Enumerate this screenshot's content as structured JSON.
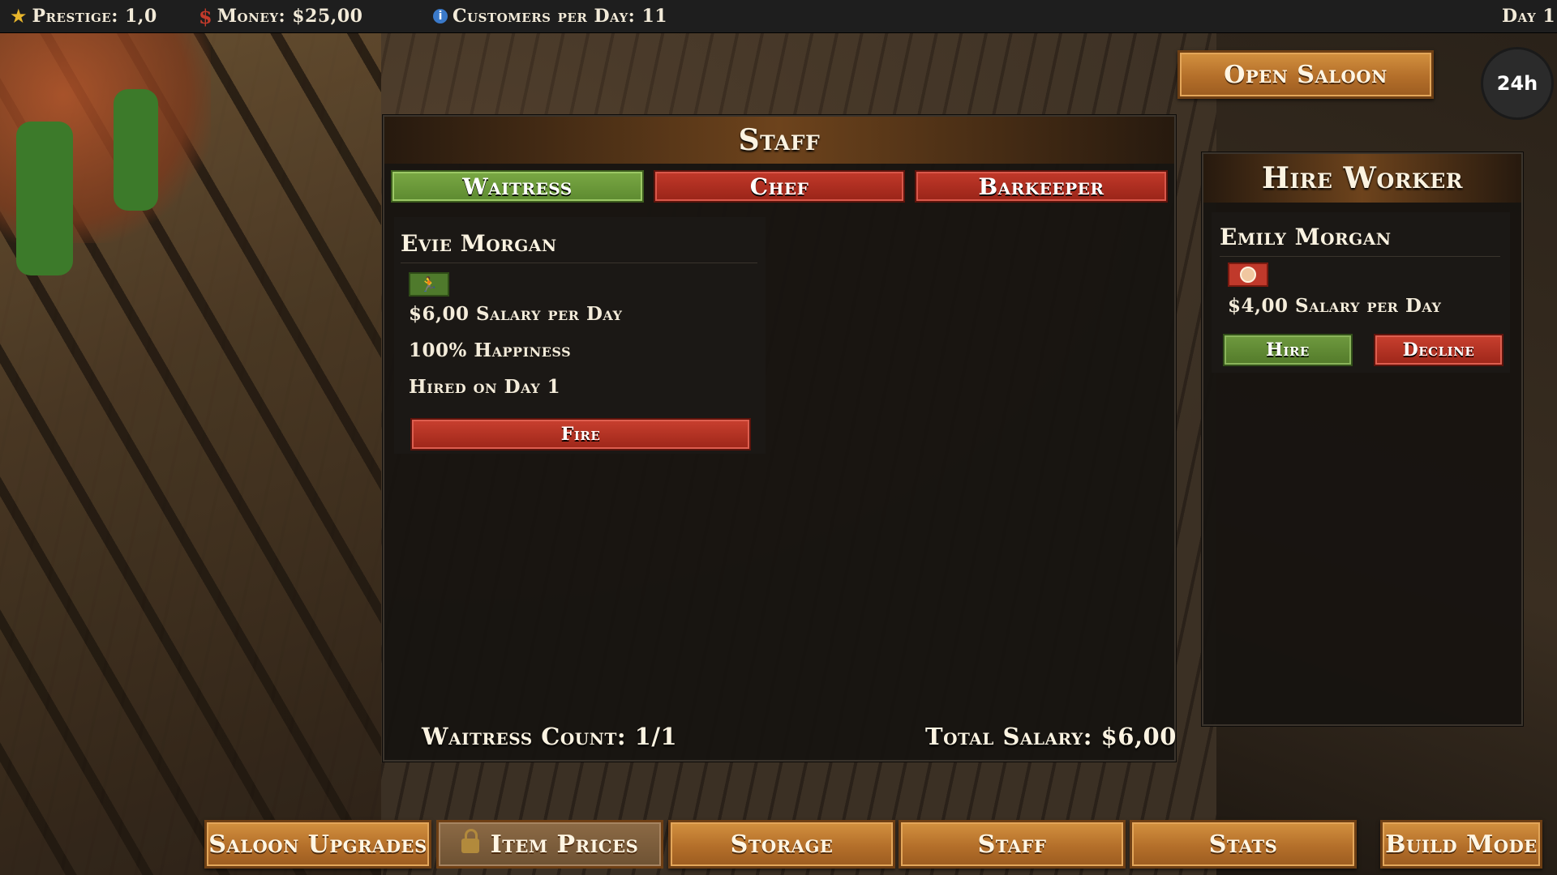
{
  "topbar": {
    "prestige": "Prestige: 1,0",
    "money": "Money: $25,00",
    "customers": "Customers per Day: 11",
    "day": "Day 1"
  },
  "header_actions": {
    "open_saloon": "Open Saloon",
    "clock": "24h"
  },
  "staff_panel": {
    "title": "Staff",
    "tabs": [
      {
        "label": "Waitress",
        "active": true
      },
      {
        "label": "Chef",
        "active": false
      },
      {
        "label": "Barkeeper",
        "active": false
      }
    ],
    "worker": {
      "name": "Evie Morgan",
      "role_icon": "running-waitress-icon",
      "salary": "$6,00 Salary per Day",
      "happiness": "100% Happiness",
      "hired": "Hired on Day 1",
      "fire_label": "Fire"
    },
    "count": "Waitress Count: 1/1",
    "total_salary": "Total Salary: $6,00"
  },
  "hire_panel": {
    "title": "Hire Worker",
    "candidate": {
      "name": "Emily Morgan",
      "icon": "face-icon",
      "salary": "$4,00 Salary per Day",
      "hire_label": "Hire",
      "decline_label": "Decline"
    }
  },
  "bottom_bar": {
    "saloon_upgrades": "Saloon Upgrades",
    "item_prices": "Item Prices",
    "storage": "Storage",
    "staff": "Staff",
    "stats": "Stats",
    "build_mode": "Build Mode"
  },
  "colors": {
    "active_tab": "#6f9a3f",
    "inactive_tab": "#b1301f",
    "wood": "#c1802f"
  }
}
